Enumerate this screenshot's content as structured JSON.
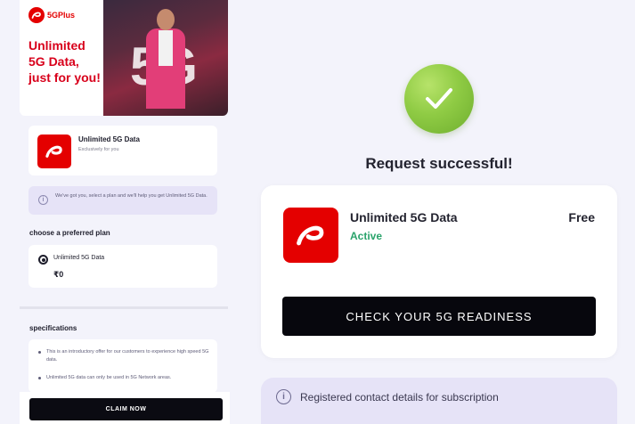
{
  "banner": {
    "brand": "5GPlus",
    "headline": "Unlimited\n5G Data,\njust for you!",
    "photo_text": "5G"
  },
  "plan_card": {
    "title": "Unlimited 5G Data",
    "subtitle": "Exclusively for you"
  },
  "info_note": "We've got you, select a plan and we'll help you get Unlimited 5G Data.",
  "plans": {
    "heading": "choose a preferred plan",
    "options": [
      {
        "label": "Unlimited 5G Data",
        "price": "₹0",
        "selected": true
      }
    ]
  },
  "specifications": {
    "heading": "specifications",
    "items": [
      "This is an introductory offer for our customers to experience high speed 5G data.",
      "Unlimited 5G data can only be used in 5G Network areas."
    ]
  },
  "claim_button": "CLAIM NOW",
  "success": {
    "title": "Request successful!",
    "plan_title": "Unlimited 5G Data",
    "status": "Active",
    "price": "Free",
    "readiness_button": "CHECK YOUR 5G READINESS",
    "contact_note": "Registered contact details for subscription"
  },
  "colors": {
    "brand_red": "#e40000",
    "success_green": "#8fcb44",
    "active_text": "#2aa36b",
    "info_bg": "#e6e3f7",
    "button_black": "#07070d"
  }
}
